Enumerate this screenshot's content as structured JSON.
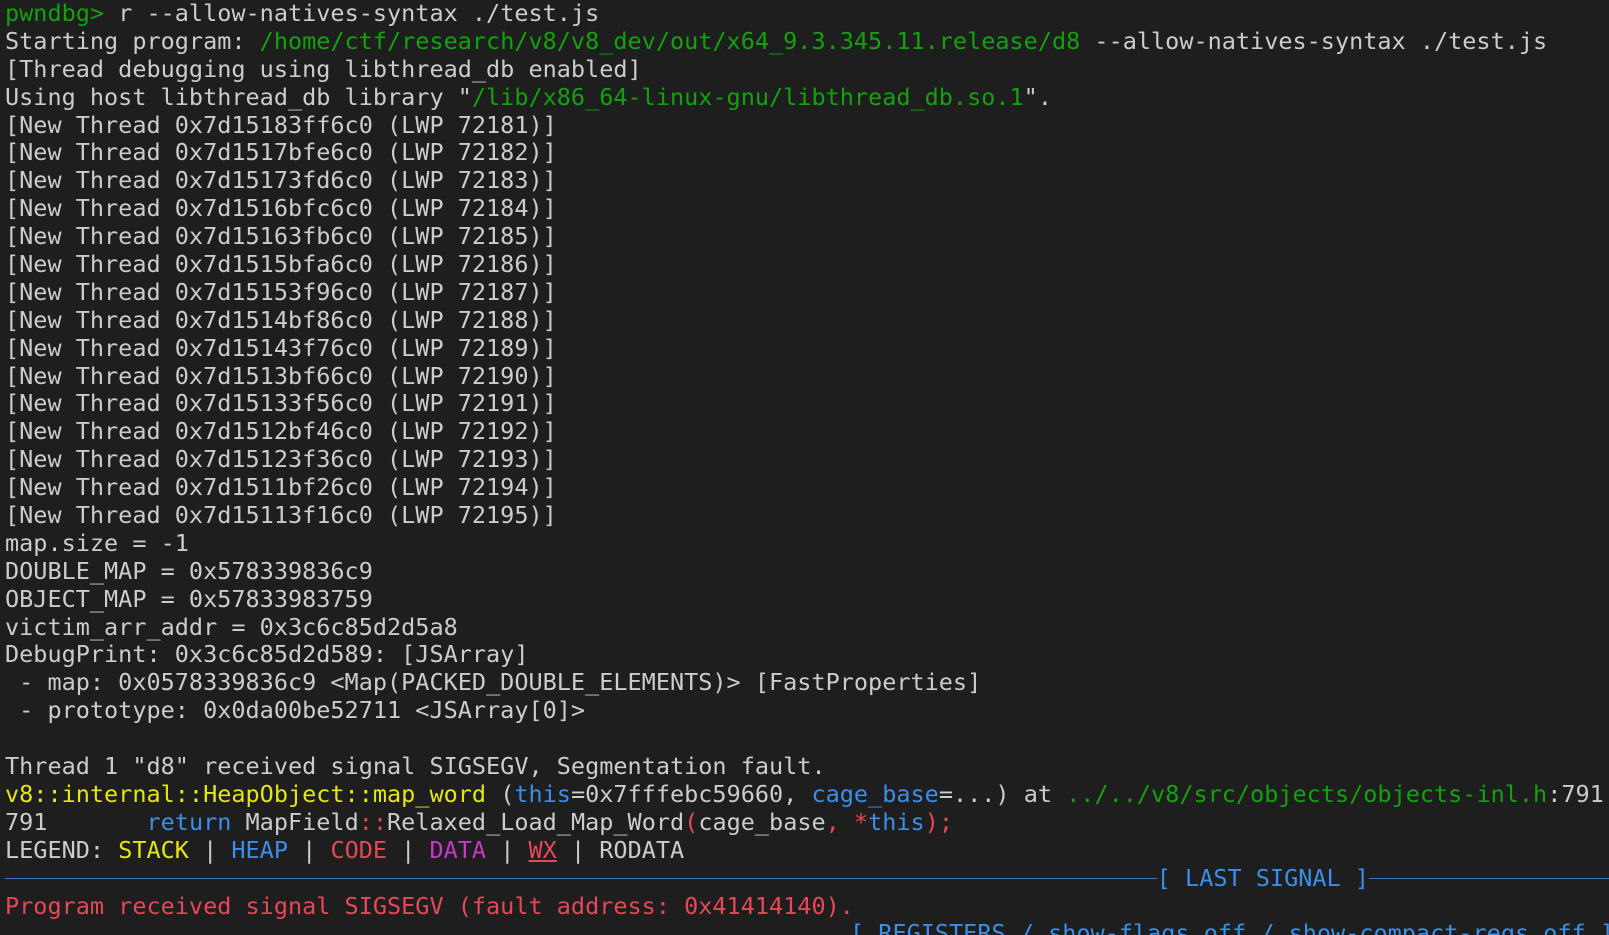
{
  "terminal": {
    "prompt": "pwndbg>",
    "command": " r --allow-natives-syntax ./test.js",
    "starting": {
      "label": "Starting program: ",
      "path": "/home/ctf/research/v8/v8_dev/out/x64_9.3.345.11.release/d8",
      "args": " --allow-natives-syntax ./test.js"
    },
    "thread_debugging": "[Thread debugging using libthread_db enabled]",
    "libthread": {
      "prefix": "Using host libthread_db library \"",
      "path": "/lib/x86_64-linux-gnu/libthread_db.so.1",
      "suffix": "\"."
    },
    "threads": [
      "[New Thread 0x7d15183ff6c0 (LWP 72181)]",
      "[New Thread 0x7d1517bfe6c0 (LWP 72182)]",
      "[New Thread 0x7d15173fd6c0 (LWP 72183)]",
      "[New Thread 0x7d1516bfc6c0 (LWP 72184)]",
      "[New Thread 0x7d15163fb6c0 (LWP 72185)]",
      "[New Thread 0x7d1515bfa6c0 (LWP 72186)]",
      "[New Thread 0x7d15153f96c0 (LWP 72187)]",
      "[New Thread 0x7d1514bf86c0 (LWP 72188)]",
      "[New Thread 0x7d15143f76c0 (LWP 72189)]",
      "[New Thread 0x7d1513bf66c0 (LWP 72190)]",
      "[New Thread 0x7d15133f56c0 (LWP 72191)]",
      "[New Thread 0x7d1512bf46c0 (LWP 72192)]",
      "[New Thread 0x7d15123f36c0 (LWP 72193)]",
      "[New Thread 0x7d1511bf26c0 (LWP 72194)]",
      "[New Thread 0x7d15113f16c0 (LWP 72195)]"
    ],
    "output": [
      "map.size = -1",
      "DOUBLE_MAP = 0x578339836c9",
      "OBJECT_MAP = 0x57833983759",
      "victim_arr_addr = 0x3c6c85d2d5a8",
      "DebugPrint: 0x3c6c85d2d589: [JSArray]",
      " - map: 0x0578339836c9 <Map(PACKED_DOUBLE_ELEMENTS)> [FastProperties]",
      " - prototype: 0x0da00be52711 <JSArray[0]>"
    ],
    "signal_line": "Thread 1 \"d8\" received signal SIGSEGV, Segmentation fault.",
    "frame": {
      "func": "v8::internal::HeapObject::map_word",
      "open": " (",
      "this_kw": "this",
      "this_val": "=0x7fffebc59660, ",
      "cage_kw": "cage_base",
      "cage_val": "=...) at ",
      "file": "../../v8/src/objects/objects-inl.h",
      "line_ref": ":791"
    },
    "source": {
      "lineno": "791",
      "indent": "       ",
      "kw_return": "return",
      "call": " MapField",
      "scope": "::",
      "method": "Relaxed_Load_Map_Word",
      "paren_open": "(",
      "arg1": "cage_base",
      "comma": ", ",
      "star": "*",
      "arg2": "this",
      "end": ");"
    },
    "legend": {
      "label": "LEGEND: ",
      "stack": "STACK",
      "heap": "HEAP",
      "code": "CODE",
      "data": "DATA",
      "wx": "WX",
      "rodata": "RODATA",
      "pipe": " | "
    },
    "last_signal_title": "[ LAST SIGNAL ]",
    "program_signal": "Program received signal SIGSEGV (fault address: 0x41414140).",
    "registers_title": "[ REGISTERS / show-flags off / show-compact-regs off ]"
  },
  "colors": {
    "background": "#1e1e1e",
    "text": "#cccccc",
    "green": "#13a10e",
    "yellow": "#e5e510",
    "blue": "#3b8eea",
    "red": "#e74856",
    "magenta": "#c839c5"
  }
}
